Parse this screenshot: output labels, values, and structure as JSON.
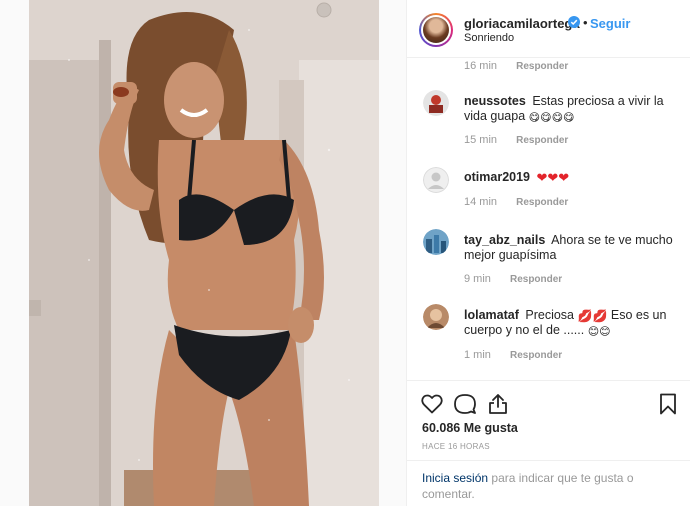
{
  "post": {
    "author": {
      "username": "gloriacamilaortega",
      "verified_icon": "verified-badge-icon",
      "separator": "•",
      "follow_label": "Seguir",
      "location": "Sonriendo"
    },
    "comments": [
      {
        "username": "",
        "text": "",
        "time": "16 min",
        "reply_label": "Responder"
      },
      {
        "username": "neussotes",
        "text": "Estas preciosa a vivir la vida guapa",
        "emoji": "😋😋😋😋",
        "time": "15 min",
        "reply_label": "Responder"
      },
      {
        "username": "otimar2019",
        "text": "",
        "emoji": "❤❤❤",
        "time": "14 min",
        "reply_label": "Responder"
      },
      {
        "username": "tay_abz_nails",
        "text": "Ahora se te ve mucho mejor guapísima",
        "time": "9 min",
        "reply_label": "Responder"
      },
      {
        "username": "lolamataf",
        "text_a": "Preciosa",
        "emoji_a": "💋💋",
        "text_b": "Eso es un cuerpo y no el de ......",
        "emoji_b": "😊😊",
        "time": "1 min",
        "reply_label": "Responder"
      }
    ],
    "actions": {
      "like_icon": "heart-outline-icon",
      "comment_icon": "comment-bubble-icon",
      "share_icon": "share-upload-icon",
      "save_icon": "bookmark-icon"
    },
    "likes": "60.086 Me gusta",
    "posted_ago": "HACE 16 HORAS",
    "login_prompt": {
      "link": "Inicia sesión",
      "text": "para indicar que te gusta o comentar."
    }
  },
  "colors": {
    "follow": "#3897f0",
    "link": "#003569",
    "muted": "#999999",
    "heart": "#e3242b"
  }
}
